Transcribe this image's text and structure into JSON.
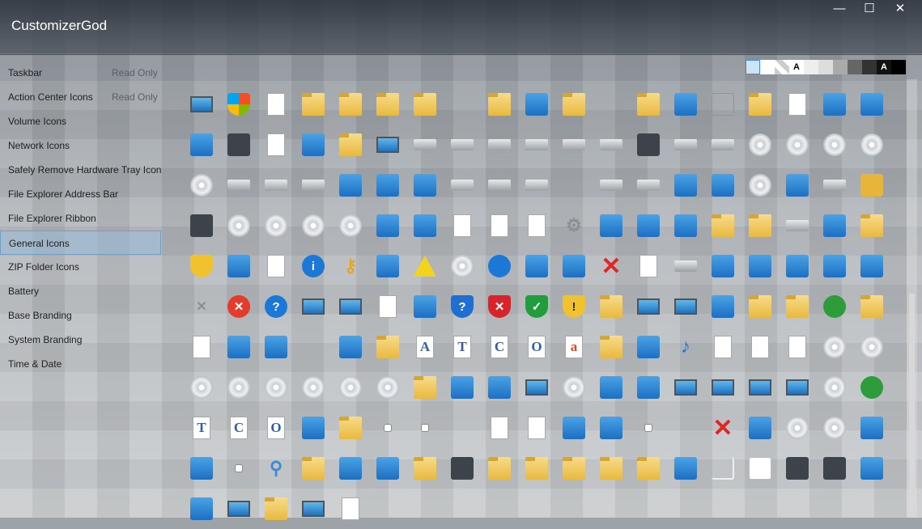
{
  "window": {
    "title": "CustomizerGod",
    "minimize_glyph": "—",
    "maximize_glyph": "☐",
    "close_glyph": "✕"
  },
  "sidebar": {
    "items": [
      {
        "label": "Taskbar",
        "note": "Read Only"
      },
      {
        "label": "Action Center Icons",
        "note": "Read Only"
      },
      {
        "label": "Volume Icons",
        "note": ""
      },
      {
        "label": "Network Icons",
        "note": ""
      },
      {
        "label": "Safely Remove Hardware Tray Icon",
        "note": ""
      },
      {
        "label": "File Explorer Address Bar",
        "note": ""
      },
      {
        "label": "File Explorer Ribbon",
        "note": ""
      },
      {
        "label": "General Icons",
        "note": "",
        "selected": true
      },
      {
        "label": "ZIP Folder Icons",
        "note": ""
      },
      {
        "label": "Battery",
        "note": ""
      },
      {
        "label": "Base Branding",
        "note": ""
      },
      {
        "label": "System Branding",
        "note": ""
      },
      {
        "label": "Time & Date",
        "note": ""
      }
    ]
  },
  "background_swatches": [
    {
      "name": "light-blue",
      "color": "#cfe3f7",
      "text": ""
    },
    {
      "name": "white",
      "color": "#ffffff",
      "text": ""
    },
    {
      "name": "checker",
      "color": "#e8e8e8",
      "text": ""
    },
    {
      "name": "white-a",
      "color": "#ffffff",
      "text": "A"
    },
    {
      "name": "light-gray-1",
      "color": "#eeeeee",
      "text": ""
    },
    {
      "name": "light-gray-2",
      "color": "#dddddd",
      "text": ""
    },
    {
      "name": "mid-gray",
      "color": "#aaaaaa",
      "text": ""
    },
    {
      "name": "dark-gray",
      "color": "#666666",
      "text": ""
    },
    {
      "name": "charcoal",
      "color": "#333333",
      "text": ""
    },
    {
      "name": "black-a",
      "color": "#111111",
      "text": "A"
    },
    {
      "name": "black",
      "color": "#000000",
      "text": ""
    }
  ],
  "icons": [
    "computer-management-icon",
    "windows-shield-icon",
    "blank-page-icon",
    "folder-icon",
    "folder-open-icon",
    "folder-icon",
    "folder-thin-icon",
    "spacer",
    "search-folder-icon",
    "book-icon",
    "blue-folder-icon",
    "spacer",
    "settings-folder-icon",
    "window-icon",
    "empty-box-icon",
    "folder-search-icon",
    "text-page-icon",
    "envelope-icon",
    "picture-icon",
    "music-sheet-icon",
    "film-icon",
    "check-document-icon",
    "network-globe-icon",
    "folder-printer-icon",
    "control-panel-icon",
    "drive-icon",
    "drive-icon",
    "optical-drive-icon",
    "drive-error-icon",
    "drive-icon",
    "drive-green-icon",
    "ram-icon",
    "drive-icon",
    "windows-drive-icon",
    "dvd-drive-icon",
    "dvd-r-disc-icon",
    "dvd-ram-disc-icon",
    "dvd-rom-disc-icon",
    "dvd-rw-disc-icon",
    "floppy-drive-icon",
    "usb-drive-icon",
    "network-drive-icon",
    "printer-globe-icon",
    "camcorder-icon",
    "phone-icon",
    "drive-icon",
    "drive-check-icon",
    "drive-check-icon",
    "spacer",
    "drive-check-icon",
    "drive-icon",
    "recycle-bin-empty-icon",
    "recycle-bin-full-icon",
    "dvd-disc-icon",
    "camera-icon",
    "locked-drive-icon",
    "lock-icon",
    "sd-card-icon",
    "disc-icon",
    "cd-r-disc-icon",
    "cd-rom-disc-icon",
    "cd-rw-disc-icon",
    "photo-book-icon",
    "media-player-icon",
    "gear-page-icon",
    "gear-page-icon",
    "gear-doc-icon",
    "gear-icon",
    "photo-icon",
    "landscape-icon",
    "landscape-icon",
    "network-folder-icon",
    "network-folder-icon",
    "help-drive-icon",
    "scanner-icon",
    "fonts-folder-icon",
    "uac-shield-icon",
    "users-icon",
    "checklist-icon",
    "info-icon",
    "key-icon",
    "pictures-icon",
    "warning-icon",
    "media-disc-icon",
    "sync-icon",
    "media-tool-icon",
    "users-icon",
    "red-x-icon",
    "document-icon",
    "drive-stack-icon",
    "tablet-icon",
    "phone-icon",
    "input-icon",
    "scanner-icon",
    "book-icon",
    "small-x-icon",
    "error-icon",
    "help-icon",
    "panel-icon",
    "monitor-icon",
    "text-doc-icon",
    "presentation-icon",
    "help-shield-icon",
    "error-shield-icon",
    "ok-shield-icon",
    "warning-shield-icon",
    "music-folder-icon",
    "laptop-icon",
    "monitor-blue-icon",
    "apps-icon",
    "doc-folder-icon",
    "pictures-folder-icon",
    "settings-check-icon",
    "favorites-folder-icon",
    "list-icon",
    "clock-icon",
    "network-icon",
    "spacer",
    "pictures-icon",
    "user-folder-icon",
    "font-a-icon",
    "font-t-icon",
    "font-c-icon",
    "font-o-icon",
    "font-a-red-icon",
    "fonts-folder-icon",
    "briefcase-icon",
    "music-note-icon",
    "image-doc-icon",
    "film-doc-icon",
    "music-doc-icon",
    "dvd-video-icon",
    "dvd-video-icon",
    "audio-cd-icon",
    "dvd-film-icon",
    "hd-dvd-icon",
    "bd-disc-icon",
    "vcd-disc-icon",
    "svcd-disc-icon",
    "green-folder-icon",
    "globe-icon",
    "clock-icon",
    "monitor-search-icon",
    "help-disc-icon",
    "sync-arrow-icon",
    "blue-box-icon",
    "laptop-icon",
    "activity-monitor-icon",
    "network-monitor-icon",
    "network-monitor-icon",
    "disc-red-icon",
    "green-check-icon",
    "font-tt-icon",
    "font-tc-icon",
    "font-o-icon",
    "memory-icon",
    "zip-folder-icon",
    "shortcut-icon",
    "small-picture-icon",
    "spacer",
    "checklist-icon",
    "task-doc-icon",
    "printer-error-icon",
    "card-icon",
    "download-icon",
    "spacer",
    "red-x-icon",
    "move-icon",
    "dvd-r-icon",
    "dvd-rw-icon",
    "zip-icon",
    "compress-icon",
    "speaker-icon",
    "search-icon",
    "user-folder-icon",
    "internet-icon",
    "add-music-icon",
    "contacts-folder-icon",
    "keyboard-icon",
    "display-folder-icon",
    "downloads-folder-icon",
    "shared-folder-icon",
    "settings-folder-icon",
    "videos-folder-icon",
    "book-green-icon",
    "blank-icon",
    "white-box-icon",
    "film-strip-icon",
    "film-frame-icon",
    "security-globe-icon",
    "fax-icon",
    "laptop-screen-icon",
    "folder-icon",
    "computer-icon",
    "document-icon"
  ]
}
